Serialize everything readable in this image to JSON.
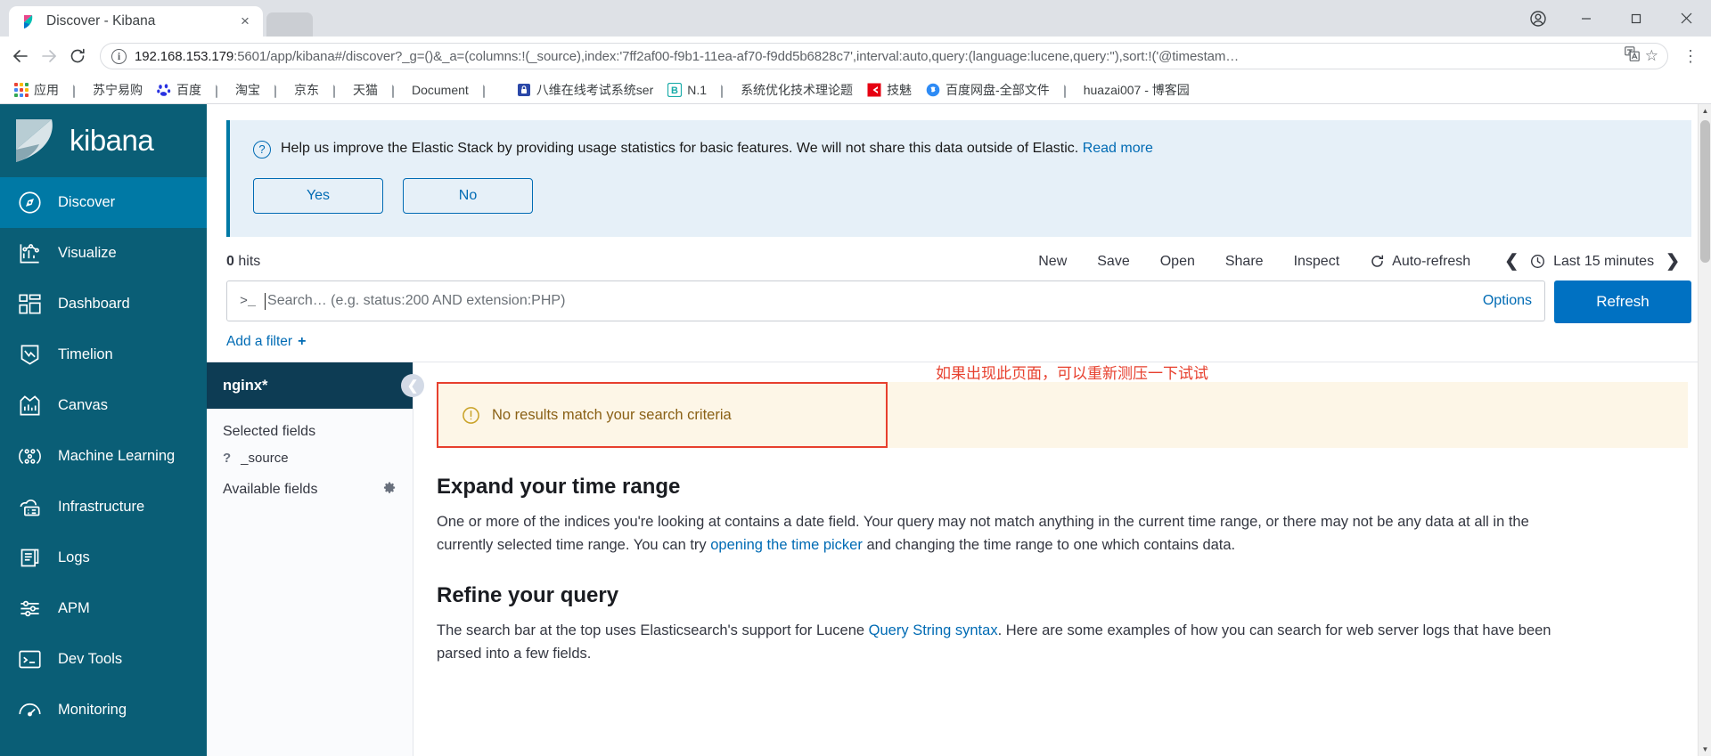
{
  "browser": {
    "tab": {
      "title": "Discover - Kibana",
      "favicon": "kibana-icon",
      "close": "×"
    },
    "nav": {
      "back": "←",
      "forward": "→",
      "reload": "↻"
    },
    "omnibox": {
      "info_icon": "i",
      "url_host": "192.168.153.179",
      "url_rest": ":5601/app/kibana#/discover?_g=()&_a=(columns:!(_source),index:'7ff2af00-f9b1-11ea-af70-f9dd5b6828c7',interval:auto,query:(language:lucene,query:''),sort:!('@timestam…",
      "translate_icon": "translate-icon",
      "bookmark_icon": "☆",
      "menu_icon": "⋮"
    },
    "window": {
      "profile": "●",
      "minimize": "─",
      "maximize": "☐",
      "close": "✕"
    },
    "bookmarks": [
      {
        "label": "应用",
        "icon": "apps-grid-icon"
      },
      {
        "label": "苏宁易购",
        "icon": "page-icon"
      },
      {
        "label": "百度",
        "icon": "baidu-icon"
      },
      {
        "label": "淘宝",
        "icon": "page-icon"
      },
      {
        "label": "京东",
        "icon": "page-icon"
      },
      {
        "label": "天猫",
        "icon": "page-icon"
      },
      {
        "label": "Document",
        "icon": "page-icon"
      },
      {
        "label": "",
        "icon": "page-icon"
      },
      {
        "label": "八维在线考试系统ser",
        "icon": "blue-lock-icon"
      },
      {
        "label": "N.1",
        "icon": "letter-b-icon"
      },
      {
        "label": "系统优化技术理论题",
        "icon": "page-icon"
      },
      {
        "label": "技魅",
        "icon": "red-c-icon"
      },
      {
        "label": "百度网盘-全部文件",
        "icon": "baiduyun-icon"
      },
      {
        "label": "huazai007 - 博客园",
        "icon": "page-icon"
      }
    ]
  },
  "kibana": {
    "brand": "kibana",
    "sidebar": [
      {
        "label": "Discover",
        "icon": "compass-icon",
        "active": true
      },
      {
        "label": "Visualize",
        "icon": "chart-icon",
        "active": false
      },
      {
        "label": "Dashboard",
        "icon": "dashboard-icon",
        "active": false
      },
      {
        "label": "Timelion",
        "icon": "timelion-icon",
        "active": false
      },
      {
        "label": "Canvas",
        "icon": "canvas-icon",
        "active": false
      },
      {
        "label": "Machine Learning",
        "icon": "ml-icon",
        "active": false
      },
      {
        "label": "Infrastructure",
        "icon": "infrastructure-icon",
        "active": false
      },
      {
        "label": "Logs",
        "icon": "logs-icon",
        "active": false
      },
      {
        "label": "APM",
        "icon": "apm-icon",
        "active": false
      },
      {
        "label": "Dev Tools",
        "icon": "devtools-icon",
        "active": false
      },
      {
        "label": "Monitoring",
        "icon": "monitoring-icon",
        "active": false
      }
    ],
    "telemetry": {
      "icon": "question-icon",
      "message": "Help us improve the Elastic Stack by providing usage statistics for basic features. We will not share this data outside of Elastic.",
      "link": "Read more",
      "yes": "Yes",
      "no": "No"
    },
    "toolbar": {
      "hits_count": "0",
      "hits_label": "hits",
      "new": "New",
      "save": "Save",
      "open": "Open",
      "share": "Share",
      "inspect": "Inspect",
      "auto_refresh": "Auto-refresh",
      "auto_refresh_icon": "refresh-icon",
      "prev_icon": "❮",
      "next_icon": "❯",
      "clock_icon": "clock-icon",
      "time_range": "Last 15 minutes"
    },
    "query": {
      "prompt": ">_",
      "placeholder": "Search… (e.g. status:200 AND extension:PHP)",
      "value": "",
      "options": "Options",
      "refresh": "Refresh"
    },
    "filters": {
      "add_label": "Add a filter",
      "plus": "+"
    },
    "fields": {
      "index_pattern": "nginx*",
      "collapse_icon": "❮",
      "selected_title": "Selected fields",
      "selected": [
        {
          "type": "?",
          "name": "_source"
        }
      ],
      "available_title": "Available fields",
      "gear_icon": "gear-icon"
    },
    "results": {
      "warning_icon": "warning-icon",
      "no_results": "No results match your search criteria",
      "annotation": "如果出现此页面，可以重新测压一下试试",
      "annotation_color": "#e7402e",
      "box_border_color": "#e7402e",
      "sections": [
        {
          "heading": "Expand your time range",
          "text_before": "One or more of the indices you're looking at contains a date field. Your query may not match anything in the current time range, or there may not be any data at all in the currently selected time range. You can try ",
          "link": "opening the time picker",
          "text_after": " and changing the time range to one which contains data."
        },
        {
          "heading": "Refine your query",
          "text_before": "The search bar at the top uses Elasticsearch's support for Lucene ",
          "link": "Query String syntax",
          "text_after": ". Here are some examples of how you can search for web server logs that have been parsed into a few fields."
        }
      ]
    }
  },
  "colors": {
    "kibana_sidebar": "#0a5e76",
    "kibana_active": "#0079a5",
    "accent_link": "#006bb4",
    "refresh_button": "#0071c2",
    "warning_bg": "#fdf6e7",
    "warning_text": "#8a6116",
    "red_annotation": "#e7402e",
    "index_header": "#0d3c54"
  }
}
